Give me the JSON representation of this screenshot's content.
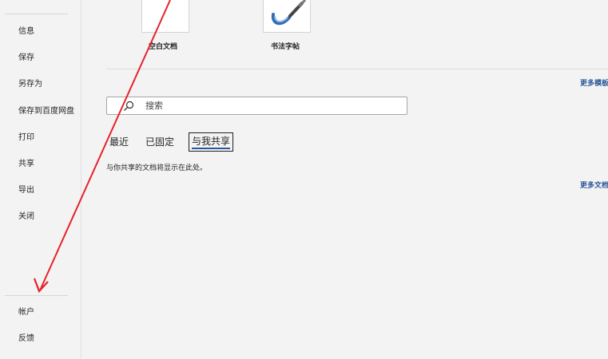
{
  "sidebar": {
    "items": [
      {
        "label": "信息"
      },
      {
        "label": "保存"
      },
      {
        "label": "另存为"
      },
      {
        "label": "保存到百度网盘"
      },
      {
        "label": "打印"
      },
      {
        "label": "共享"
      },
      {
        "label": "导出"
      },
      {
        "label": "关闭"
      }
    ],
    "bottom_items": [
      {
        "label": "帐户"
      },
      {
        "label": "反馈"
      }
    ]
  },
  "templates": {
    "items": [
      {
        "label": "空白文档",
        "icon": "blank-document-icon"
      },
      {
        "label": "书法字帖",
        "icon": "calligraphy-brush-icon"
      }
    ],
    "more_label": "更多模板"
  },
  "search": {
    "placeholder": "搜索",
    "value": ""
  },
  "tabs": {
    "items": [
      {
        "label": "最近"
      },
      {
        "label": "已固定"
      },
      {
        "label": "与我共享"
      }
    ],
    "active": "与我共享"
  },
  "shared": {
    "empty_message": "与你共享的文档将显示在此处。",
    "more_label": "更多文档"
  },
  "colors": {
    "accent": "#2b579a",
    "annotation_arrow": "#e8212a",
    "background": "#f3f3f3"
  }
}
